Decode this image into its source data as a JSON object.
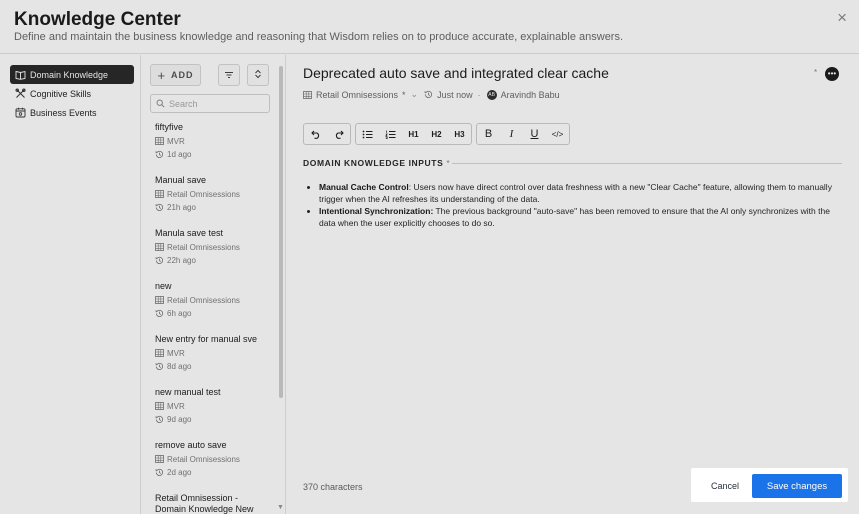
{
  "header": {
    "title": "Knowledge Center",
    "subtitle": "Define and maintain the business knowledge and reasoning that Wisdom relies on to produce accurate, explainable answers.",
    "close_glyph": "×"
  },
  "nav": {
    "items": [
      {
        "label": "Domain Knowledge",
        "icon": "book-icon",
        "active": true
      },
      {
        "label": "Cognitive Skills",
        "icon": "tools-icon",
        "active": false
      },
      {
        "label": "Business Events",
        "icon": "calendar-icon",
        "active": false
      }
    ]
  },
  "list": {
    "add_label": "ADD",
    "search_placeholder": "Search",
    "entries": [
      {
        "name": "fiftyfive",
        "source": "MVR",
        "time": "1d ago"
      },
      {
        "name": "Manual save",
        "source": "Retail Omnisessions",
        "time": "21h ago"
      },
      {
        "name": "Manula save test",
        "source": "Retail Omnisessions",
        "time": "22h ago"
      },
      {
        "name": "new",
        "source": "Retail Omnisessions",
        "time": "6h ago"
      },
      {
        "name": "New entry for manual sve",
        "source": "MVR",
        "time": "8d ago"
      },
      {
        "name": "new manual test",
        "source": "MVR",
        "time": "9d ago"
      },
      {
        "name": "remove auto save",
        "source": "Retail Omnisessions",
        "time": "2d ago"
      }
    ],
    "last_entry_line1": "Retail Omnisession -",
    "last_entry_line2": "Domain Knowledge New"
  },
  "editor": {
    "title": "Deprecated auto save and integrated clear cache",
    "title_star": "*",
    "source": "Retail Omnisessions",
    "source_star": "*",
    "time": "Just now",
    "author": "Aravindh Babu",
    "author_initials": "AB",
    "toolbar": {
      "h1": "H1",
      "h2": "H2",
      "h3": "H3",
      "bold": "B",
      "italic": "I",
      "underline": "U",
      "code": "</>"
    },
    "section_label": "DOMAIN KNOWLEDGE INPUTS",
    "section_star": "*",
    "bullets": [
      {
        "bold": "Manual Cache Control",
        "text": ": Users now have direct control over data freshness with a new \"Clear Cache\" feature, allowing them to manually trigger when the AI refreshes its understanding of the data."
      },
      {
        "bold": "Intentional Synchronization:",
        "text": " The previous background \"auto-save\" has been removed to ensure that the AI only synchronizes with the data when the user explicitly chooses to do so."
      }
    ],
    "char_count": "370 characters"
  },
  "actions": {
    "cancel": "Cancel",
    "save": "Save changes"
  },
  "colors": {
    "accent": "#1a73e8",
    "nav_active": "#2b2b2b"
  }
}
